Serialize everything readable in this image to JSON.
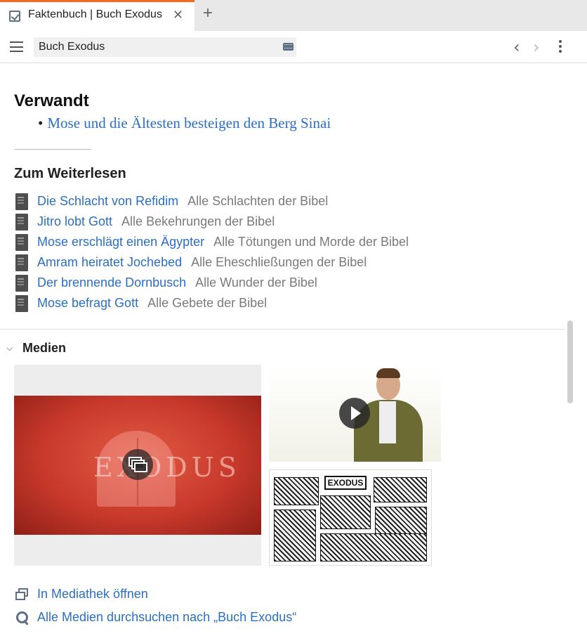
{
  "tab": {
    "title": "Faktenbuch | Buch Exodus",
    "close": "✕",
    "add": "+"
  },
  "toolbar": {
    "search_value": "Buch Exodus",
    "back": "‹",
    "forward": "›"
  },
  "related": {
    "heading": "Verwandt",
    "link": "Mose und die Ältesten besteigen den Berg Sinai"
  },
  "further": {
    "heading": "Zum Weiterlesen",
    "items": [
      {
        "title": "Die Schlacht von Refidim",
        "category": "Alle Schlachten der Bibel"
      },
      {
        "title": "Jitro lobt Gott",
        "category": "Alle Bekehrungen der Bibel"
      },
      {
        "title": "Mose erschlägt einen Ägypter",
        "category": "Alle Tötungen und Morde der Bibel"
      },
      {
        "title": "Amram heiratet Jochebed",
        "category": "Alle Eheschließungen der Bibel"
      },
      {
        "title": "Der brennende Dornbusch",
        "category": "Alle Wunder der Bibel"
      },
      {
        "title": "Mose befragt Gott",
        "category": "Alle Gebete der Bibel"
      }
    ]
  },
  "media": {
    "heading": "Medien",
    "big_image_text": "EXODUS",
    "comic_title": "EXODUS",
    "open_library": "In Mediathek öffnen",
    "search_all": "Alle Medien durchsuchen nach „Buch Exodus“"
  },
  "colors": {
    "accent": "#f26b1d",
    "link": "#2b6fc2",
    "muted": "#7a7a7a"
  }
}
